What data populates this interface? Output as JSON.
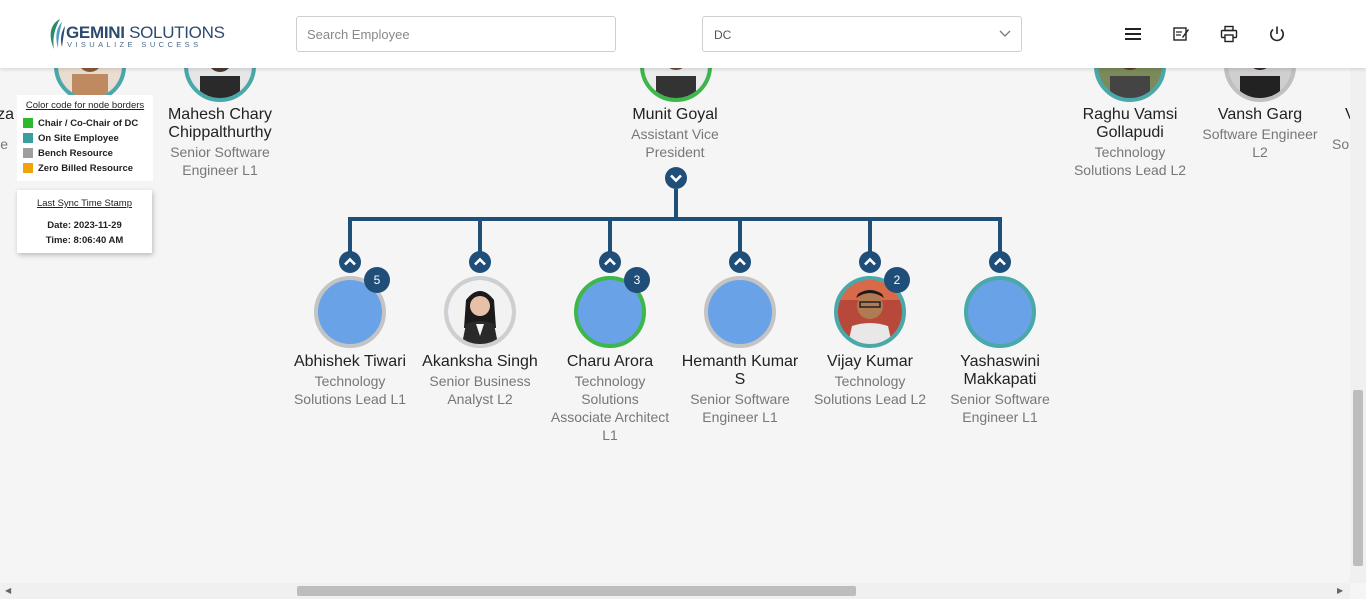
{
  "header": {
    "logo_brand": "GEMINI",
    "logo_brand_rest": " SOLUTIONS",
    "logo_tagline": "VISUALIZE SUCCESS",
    "search_placeholder": "Search Employee",
    "dc_value": "DC",
    "icons": [
      "menu-icon",
      "edit-note-icon",
      "print-icon",
      "power-icon"
    ]
  },
  "legend": {
    "title": "Color code for node borders",
    "items": [
      {
        "label": "Chair / Co-Chair of DC",
        "color": "#2db82d"
      },
      {
        "label": "On Site Employee",
        "color": "#3a9e9e"
      },
      {
        "label": "Bench Resource",
        "color": "#9e9e9e"
      },
      {
        "label": "Zero Billed Resource",
        "color": "#f0a30a"
      }
    ]
  },
  "sync": {
    "title": "Last Sync Time Stamp",
    "date": "Date: 2023-11-29",
    "time": "Time: 8:06:40 AM"
  },
  "top_row": {
    "partial_left": {
      "name": "za",
      "role": "re"
    },
    "mahesh": {
      "name_1": "Mahesh Chary",
      "name_2": "Chippalthurthy",
      "role_1": "Senior Software",
      "role_2": "Engineer L1"
    },
    "munit": {
      "name": "Munit Goyal",
      "role_1": "Assistant Vice",
      "role_2": "President"
    },
    "raghu": {
      "name_1": "Raghu Vamsi",
      "name_2": "Gollapudi",
      "role_1": "Technology",
      "role_2": "Solutions Lead L2"
    },
    "vansh": {
      "name": "Vansh Garg",
      "role_1": "Software Engineer",
      "role_2": "L2"
    },
    "partial_right": {
      "name": "V",
      "role": "So"
    }
  },
  "children": [
    {
      "name_1": "Abhishek Tiwari",
      "name_2": "",
      "role_1": "Technology",
      "role_2": "Solutions Lead L1",
      "role_3": "",
      "role_4": "",
      "badge": "5",
      "border": "gray",
      "photo": false
    },
    {
      "name_1": "Akanksha Singh",
      "name_2": "",
      "role_1": "Senior Business",
      "role_2": "Analyst L2",
      "role_3": "",
      "role_4": "",
      "badge": "",
      "border": "gray",
      "photo": true
    },
    {
      "name_1": "Charu Arora",
      "name_2": "",
      "role_1": "Technology",
      "role_2": "Solutions",
      "role_3": "Associate Architect",
      "role_4": "L1",
      "badge": "3",
      "border": "green",
      "photo": false
    },
    {
      "name_1": "Hemanth Kumar",
      "name_2": "S",
      "role_1": "Senior Software",
      "role_2": "Engineer L1",
      "role_3": "",
      "role_4": "",
      "badge": "",
      "border": "gray",
      "photo": false
    },
    {
      "name_1": "Vijay Kumar",
      "name_2": "",
      "role_1": "Technology",
      "role_2": "Solutions Lead L2",
      "role_3": "",
      "role_4": "",
      "badge": "2",
      "border": "teal",
      "photo": true
    },
    {
      "name_1": "Yashaswini",
      "name_2": "Makkapati",
      "role_1": "Senior Software",
      "role_2": "Engineer L1",
      "role_3": "",
      "role_4": "",
      "badge": "",
      "border": "teal",
      "photo": false
    }
  ],
  "colors": {
    "connector": "#1f4e79",
    "avatar_fill": "#6aa2e8",
    "teal": "#4aa8a8",
    "green": "#3db64a"
  }
}
